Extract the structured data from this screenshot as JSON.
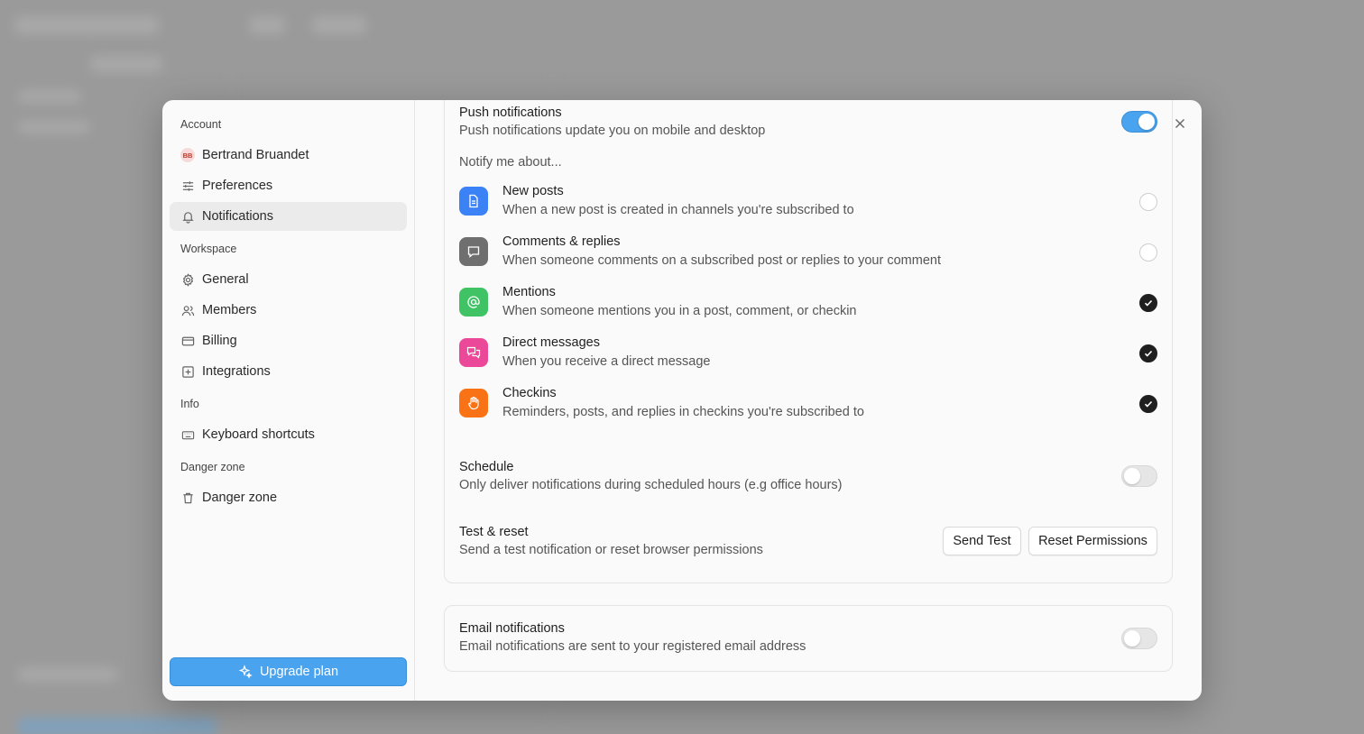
{
  "sidebar": {
    "sections": {
      "account": "Account",
      "workspace": "Workspace",
      "info": "Info",
      "danger": "Danger zone"
    },
    "user": {
      "initials": "BB",
      "name": "Bertrand Bruandet"
    },
    "items": {
      "preferences": "Preferences",
      "notifications": "Notifications",
      "general": "General",
      "members": "Members",
      "billing": "Billing",
      "integrations": "Integrations",
      "keyboard_shortcuts": "Keyboard shortcuts",
      "danger_zone": "Danger zone"
    },
    "active": "notifications",
    "upgrade_label": "Upgrade plan"
  },
  "push": {
    "title": "Push notifications",
    "description": "Push notifications update you on mobile and desktop",
    "enabled": true,
    "notify_label": "Notify me about...",
    "items": [
      {
        "title": "New posts",
        "description": "When a new post is created in channels you're subscribed to",
        "icon": "document-icon",
        "color": "#3b82f6",
        "checked": false
      },
      {
        "title": "Comments & replies",
        "description": "When someone comments on a subscribed post or replies to your comment",
        "icon": "comment-icon",
        "color": "#6f6f6f",
        "checked": false
      },
      {
        "title": "Mentions",
        "description": "When someone mentions you in a post, comment, or checkin",
        "icon": "at-icon",
        "color": "#3fc364",
        "checked": true
      },
      {
        "title": "Direct messages",
        "description": "When you receive a direct message",
        "icon": "messages-icon",
        "color": "#ec4899",
        "checked": true
      },
      {
        "title": "Checkins",
        "description": "Reminders, posts, and replies in checkins you're subscribed to",
        "icon": "hand-icon",
        "color": "#f97316",
        "checked": true
      }
    ],
    "schedule": {
      "title": "Schedule",
      "description": "Only deliver notifications during scheduled hours (e.g office hours)",
      "enabled": false
    },
    "test_reset": {
      "title": "Test & reset",
      "description": "Send a test notification or reset browser permissions",
      "send_test_label": "Send Test",
      "reset_label": "Reset Permissions"
    }
  },
  "email": {
    "title": "Email notifications",
    "description": "Email notifications are sent to your registered email address",
    "enabled": false
  },
  "colors": {
    "accent": "#4aa3ee",
    "checked": "#1f1f1f"
  }
}
